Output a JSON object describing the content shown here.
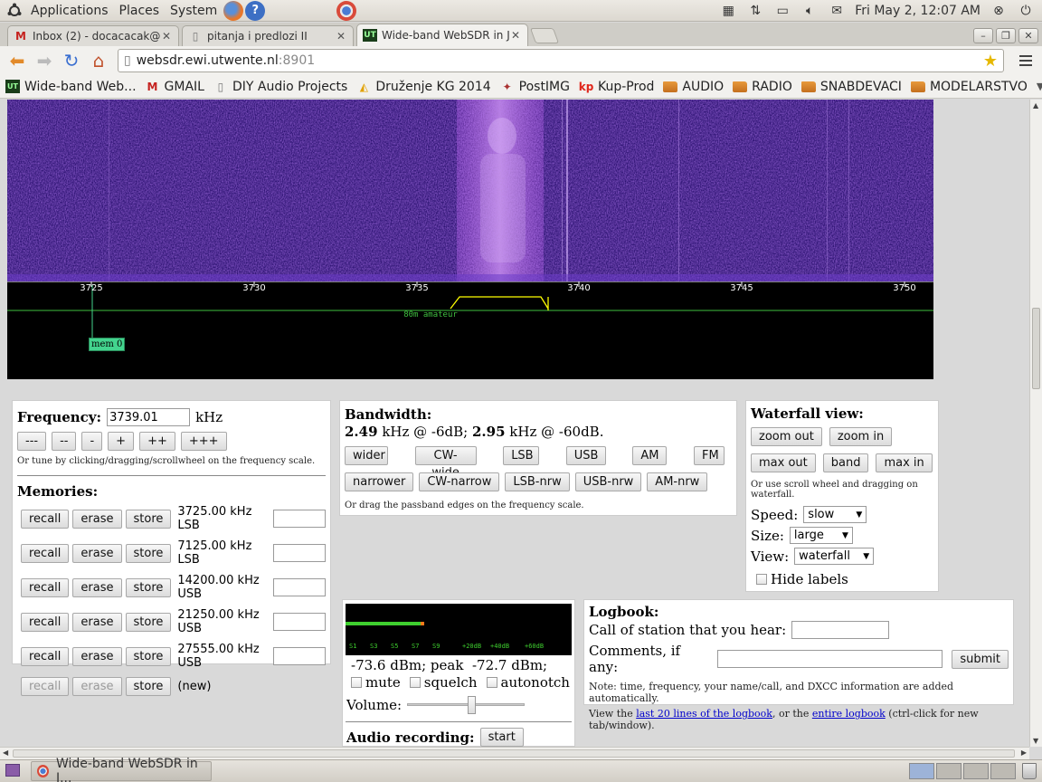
{
  "system_panel": {
    "menus": [
      "Applications",
      "Places",
      "System"
    ],
    "clock": "Fri May  2, 12:07 AM"
  },
  "tabs": [
    {
      "title": "Inbox (2) - docacacak@",
      "icon": "gmail-icon",
      "active": false
    },
    {
      "title": "pitanja i predlozi II",
      "icon": "page-icon",
      "active": false
    },
    {
      "title": "Wide-band WebSDR in J",
      "icon": "websdr-icon",
      "active": true
    }
  ],
  "address_bar": {
    "host": "websdr.ewi.utwente.nl",
    "port": ":8901"
  },
  "bookmarks": [
    {
      "label": "Wide-band Web...",
      "icon": "websdr-icon"
    },
    {
      "label": "GMAIL",
      "icon": "gmail-icon"
    },
    {
      "label": "DIY Audio Projects",
      "icon": "page-icon"
    },
    {
      "label": "Druženje KG 2014",
      "icon": "google-drive-icon"
    },
    {
      "label": "PostIMG",
      "icon": "postimg-icon"
    },
    {
      "label": "Kup-Prod",
      "icon": "kp-icon"
    },
    {
      "label": "AUDIO",
      "icon": "folder-icon"
    },
    {
      "label": "RADIO",
      "icon": "folder-icon"
    },
    {
      "label": "SNABDEVACI",
      "icon": "folder-icon"
    },
    {
      "label": "MODELARSTVO",
      "icon": "folder-icon"
    }
  ],
  "freq_scale": {
    "ticks": [
      "3725",
      "3730",
      "3735",
      "3740",
      "3745",
      "3750"
    ],
    "band_label": "80m amateur",
    "memory_marker": "mem 0",
    "passband_color": "#ffff00"
  },
  "frequency_panel": {
    "label": "Frequency:",
    "value": "3739.01",
    "unit": "kHz",
    "step_buttons": [
      "---",
      "--",
      "-",
      "+",
      "++",
      "+++"
    ],
    "hint": "Or tune by clicking/dragging/scrollwheel on the frequency scale."
  },
  "memories": {
    "title": "Memories:",
    "recall_label": "recall",
    "erase_label": "erase",
    "store_label": "store",
    "rows": [
      {
        "text": "3725.00 kHz LSB",
        "disabled": false
      },
      {
        "text": "7125.00 kHz LSB",
        "disabled": false
      },
      {
        "text": "14200.00 kHz USB",
        "disabled": false
      },
      {
        "text": "21250.00 kHz USB",
        "disabled": false
      },
      {
        "text": "27555.00 kHz USB",
        "disabled": false
      },
      {
        "text": "(new)",
        "disabled": true
      }
    ]
  },
  "bandwidth": {
    "title": "Bandwidth:",
    "bw6": "2.49",
    "bw6_text": " kHz @ -6dB; ",
    "bw60": "2.95",
    "bw60_text": " kHz @ -60dB.",
    "row1": [
      "wider",
      "CW-wide",
      "LSB",
      "USB",
      "AM",
      "FM"
    ],
    "row2": [
      "narrower",
      "CW-narrow",
      "LSB-nrw",
      "USB-nrw",
      "AM-nrw"
    ],
    "hint": "Or drag the passband edges on the frequency scale."
  },
  "waterfall_view": {
    "title": "Waterfall view:",
    "row1": [
      "zoom out",
      "zoom in"
    ],
    "row2": [
      "max out",
      "band",
      "max in"
    ],
    "hint": "Or use scroll wheel and dragging on waterfall.",
    "speed_label": "Speed:",
    "speed_value": "slow",
    "size_label": "Size:",
    "size_value": "large",
    "view_label": "View:",
    "view_value": "waterfall",
    "hide_labels": "Hide labels"
  },
  "smeter": {
    "scale": [
      "S1",
      "S3",
      "S5",
      "S7",
      "S9",
      "+20dB",
      "+40dB",
      "+60dB"
    ],
    "level_fraction": 0.33,
    "readout": "-73.6 dBm; peak  -72.7 dBm;",
    "mute": "mute",
    "squelch": "squelch",
    "autonotch": "autonotch",
    "volume_label": "Volume:",
    "volume_fraction": 0.55,
    "audio_recording": "Audio recording:",
    "start_label": "start"
  },
  "logbook": {
    "title": "Logbook:",
    "call_label": "Call of station that you hear:",
    "comments_label": "Comments, if any:",
    "submit_label": "submit",
    "note": "Note: time, frequency, your name/call, and DXCC information are added automatically.",
    "view_prefix": "View the ",
    "link1": "last 20 lines of the logbook",
    "view_middle": ", or the ",
    "link2": "entire logbook",
    "view_suffix": " (ctrl-click for new tab/window)."
  },
  "taskbar": {
    "window_title": "Wide-band WebSDR in J..."
  }
}
